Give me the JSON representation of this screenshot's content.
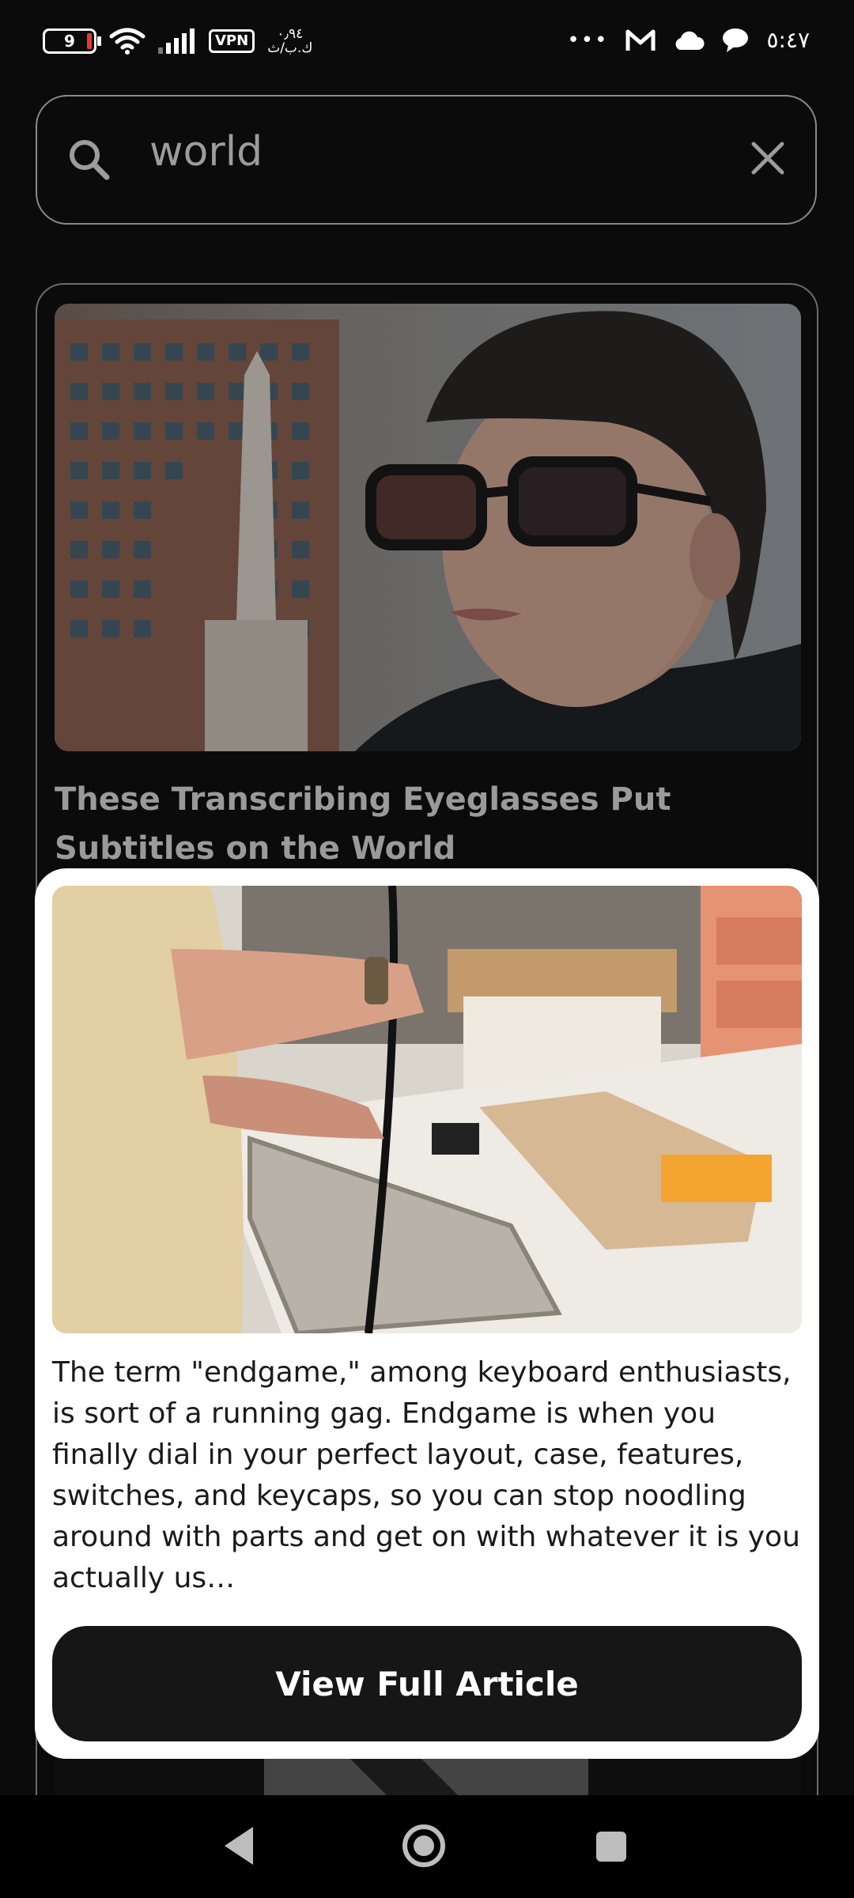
{
  "status_bar": {
    "battery_level": "9",
    "vpn_label": "VPN",
    "speed_value": "٠٫٩٤",
    "speed_unit": "ك.ب/ث",
    "time": "٥:٤٧",
    "more": "•••"
  },
  "search": {
    "query": "world"
  },
  "articles": [
    {
      "title": "These Transcribing Eyeglasses Put Subtitles on the World"
    }
  ],
  "popup": {
    "description": "The term \"endgame,\" among keyboard enthusiasts, is sort of a running gag. Endgame is when you finally dial in your perfect layout, case, features, switches, and keycaps, so you can stop noodling around with parts and get on with whatever it is you actually us…",
    "button_label": "View Full Article"
  },
  "colors": {
    "background": "#0b0b0b",
    "card_border": "#6b6b6b",
    "popup_bg": "#ffffff",
    "button_bg": "#161616"
  },
  "icons": {
    "search": "search-icon",
    "clear": "close-icon",
    "back": "back-triangle-icon",
    "home": "home-circle-icon",
    "recents": "recents-square-icon"
  }
}
